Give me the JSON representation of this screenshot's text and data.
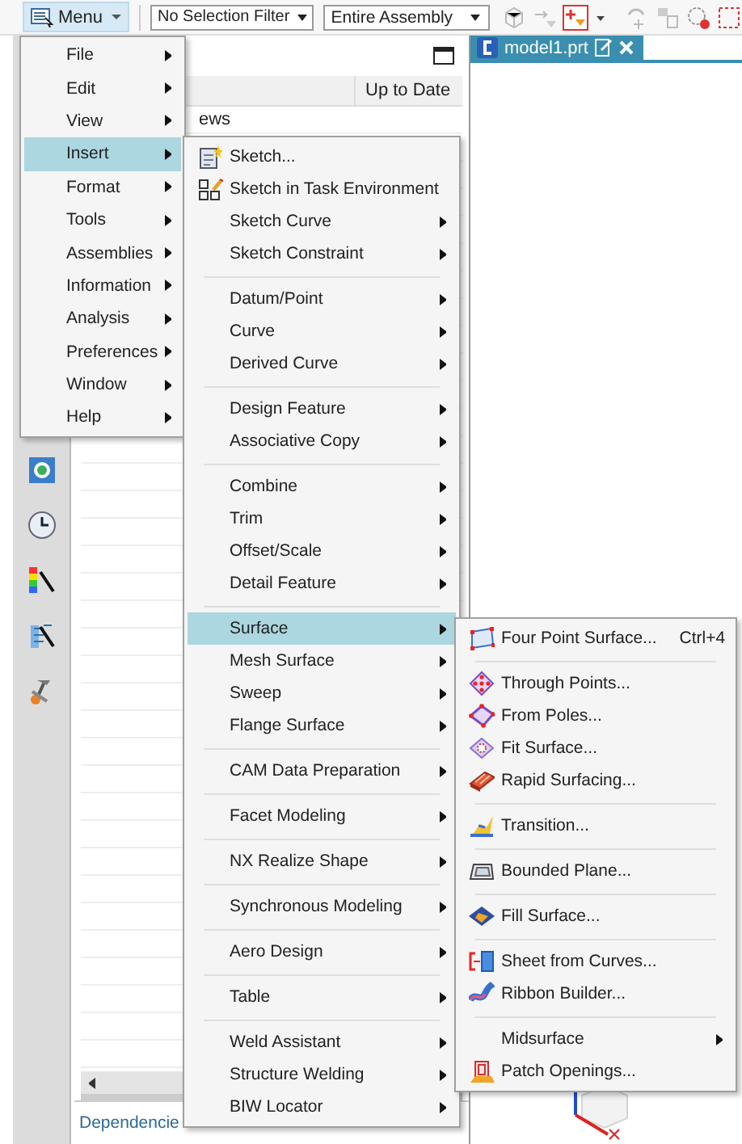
{
  "toolbar": {
    "menu_button": {
      "label": "Menu",
      "selected": true
    },
    "selection_filter": "No Selection Filter",
    "assembly_scope": "Entire Assembly"
  },
  "navigator": {
    "columns": [
      "Up to Date"
    ],
    "rows": [
      "ews"
    ],
    "bottom_tabs": [
      "Dependencie"
    ]
  },
  "graphics_tab": {
    "title": "model1.prt"
  },
  "main_menu": [
    {
      "label": "File",
      "submenu": true,
      "selected": false
    },
    {
      "label": "Edit",
      "submenu": true,
      "selected": false
    },
    {
      "label": "View",
      "submenu": true,
      "selected": false
    },
    {
      "label": "Insert",
      "submenu": true,
      "selected": true
    },
    {
      "label": "Format",
      "submenu": true,
      "selected": false
    },
    {
      "label": "Tools",
      "submenu": true,
      "selected": false
    },
    {
      "label": "Assemblies",
      "submenu": true,
      "selected": false
    },
    {
      "label": "Information",
      "submenu": true,
      "selected": false
    },
    {
      "label": "Analysis",
      "submenu": true,
      "selected": false
    },
    {
      "label": "Preferences",
      "submenu": true,
      "selected": false
    },
    {
      "label": "Window",
      "submenu": true,
      "selected": false
    },
    {
      "label": "Help",
      "submenu": true,
      "selected": false
    }
  ],
  "insert_menu": [
    [
      {
        "label": "Sketch...",
        "submenu": false,
        "selected": false
      },
      {
        "label": "Sketch in Task Environment",
        "submenu": false,
        "selected": false
      },
      {
        "label": "Sketch Curve",
        "submenu": true,
        "selected": false
      },
      {
        "label": "Sketch Constraint",
        "submenu": true,
        "selected": false
      }
    ],
    [
      {
        "label": "Datum/Point",
        "submenu": true,
        "selected": false
      },
      {
        "label": "Curve",
        "submenu": true,
        "selected": false
      },
      {
        "label": "Derived Curve",
        "submenu": true,
        "selected": false
      }
    ],
    [
      {
        "label": "Design Feature",
        "submenu": true,
        "selected": false
      },
      {
        "label": "Associative Copy",
        "submenu": true,
        "selected": false
      }
    ],
    [
      {
        "label": "Combine",
        "submenu": true,
        "selected": false
      },
      {
        "label": "Trim",
        "submenu": true,
        "selected": false
      },
      {
        "label": "Offset/Scale",
        "submenu": true,
        "selected": false
      },
      {
        "label": "Detail Feature",
        "submenu": true,
        "selected": false
      }
    ],
    [
      {
        "label": "Surface",
        "submenu": true,
        "selected": true
      },
      {
        "label": "Mesh Surface",
        "submenu": true,
        "selected": false
      },
      {
        "label": "Sweep",
        "submenu": true,
        "selected": false
      },
      {
        "label": "Flange Surface",
        "submenu": true,
        "selected": false
      }
    ],
    [
      {
        "label": "CAM Data Preparation",
        "submenu": true,
        "selected": false
      }
    ],
    [
      {
        "label": "Facet Modeling",
        "submenu": true,
        "selected": false
      }
    ],
    [
      {
        "label": "NX Realize Shape",
        "submenu": true,
        "selected": false
      }
    ],
    [
      {
        "label": "Synchronous Modeling",
        "submenu": true,
        "selected": false
      }
    ],
    [
      {
        "label": "Aero Design",
        "submenu": true,
        "selected": false
      }
    ],
    [
      {
        "label": "Table",
        "submenu": true,
        "selected": false
      }
    ],
    [
      {
        "label": "Weld Assistant",
        "submenu": true,
        "selected": false
      },
      {
        "label": "Structure Welding",
        "submenu": true,
        "selected": false
      },
      {
        "label": "BIW Locator",
        "submenu": true,
        "selected": false
      }
    ]
  ],
  "surface_menu": [
    [
      {
        "label": "Four Point Surface...",
        "shortcut": "Ctrl+4",
        "submenu": false,
        "selected": false
      }
    ],
    [
      {
        "label": "Through Points...",
        "submenu": false,
        "selected": false
      },
      {
        "label": "From Poles...",
        "submenu": false,
        "selected": false
      },
      {
        "label": "Fit Surface...",
        "submenu": false,
        "selected": false
      },
      {
        "label": "Rapid Surfacing...",
        "submenu": false,
        "selected": false
      }
    ],
    [
      {
        "label": "Transition...",
        "submenu": false,
        "selected": false
      }
    ],
    [
      {
        "label": "Bounded Plane...",
        "submenu": false,
        "selected": false
      }
    ],
    [
      {
        "label": "Fill Surface...",
        "submenu": false,
        "selected": false
      }
    ],
    [
      {
        "label": "Sheet from Curves...",
        "submenu": false,
        "selected": false
      },
      {
        "label": "Ribbon Builder...",
        "submenu": false,
        "selected": false
      }
    ],
    [
      {
        "label": "Midsurface",
        "submenu": true,
        "selected": false
      },
      {
        "label": "Patch Openings...",
        "submenu": false,
        "selected": false
      }
    ]
  ]
}
